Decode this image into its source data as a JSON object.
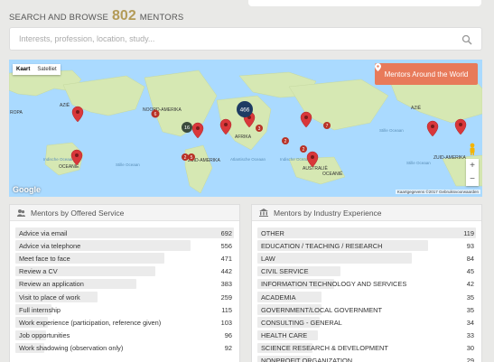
{
  "header": {
    "prefix": "SEARCH AND BROWSE",
    "count": "802",
    "suffix": "MENTORS"
  },
  "search": {
    "placeholder": "Interests, profession, location, study..."
  },
  "map": {
    "tabs": [
      "Kaart",
      "Satelliet"
    ],
    "button_label": "Mentors Around the World",
    "cluster_labels": [
      "466",
      "16",
      "6",
      "3",
      "2",
      "7",
      "2",
      "2",
      "5"
    ],
    "region_labels": [
      "ROPA",
      "AZIË",
      "NOORD-AMERIKA",
      "AFRIKA",
      "ZUID-AMERIKA",
      "AUSTRALIË",
      "OCEANIË",
      "OCEANIË",
      "AZIË",
      "Indische Oceaan",
      "Stille Oceaan",
      "Atlantische Oceaan",
      "Indische Oceaan",
      "Stille Oceaan",
      "Stille Oceaan",
      "ZUID-AMERIKA"
    ],
    "zoom_in": "+",
    "zoom_out": "−",
    "logo": "Google",
    "attribution": "Kaartgegevens ©2017   Gebruiksvoorwaarden",
    "colors": {
      "water": "#aadaff",
      "land": "#d6e8b3",
      "marker": "#d9373a",
      "button": "#e87a5a"
    }
  },
  "service_panel": {
    "title": "Mentors by Offered Service",
    "rows": [
      {
        "label": "Advice via email",
        "value": 692
      },
      {
        "label": "Advice via telephone",
        "value": 556
      },
      {
        "label": "Meet face to face",
        "value": 471
      },
      {
        "label": "Review a CV",
        "value": 442
      },
      {
        "label": "Review an application",
        "value": 383
      },
      {
        "label": "Visit to place of work",
        "value": 259
      },
      {
        "label": "Full internship",
        "value": 115
      },
      {
        "label": "Work experience (participation, reference given)",
        "value": 103
      },
      {
        "label": "Job opportunities",
        "value": 96
      },
      {
        "label": "Work shadowing (observation only)",
        "value": 92
      }
    ]
  },
  "industry_panel": {
    "title": "Mentors by Industry Experience",
    "rows": [
      {
        "label": "OTHER",
        "value": 119
      },
      {
        "label": "EDUCATION / TEACHING / RESEARCH",
        "value": 93
      },
      {
        "label": "LAW",
        "value": 84
      },
      {
        "label": "CIVIL SERVICE",
        "value": 45
      },
      {
        "label": "INFORMATION TECHNOLOGY AND SERVICES",
        "value": 42
      },
      {
        "label": "ACADEMIA",
        "value": 35
      },
      {
        "label": "GOVERNMENT/LOCAL GOVERNMENT",
        "value": 35
      },
      {
        "label": "CONSULTING - GENERAL",
        "value": 34
      },
      {
        "label": "HEALTH CARE",
        "value": 33
      },
      {
        "label": "SCIENCE RESEARCH & DEVELOPMENT",
        "value": 30
      },
      {
        "label": "NONPROFIT ORGANIZATION",
        "value": 29
      }
    ]
  }
}
